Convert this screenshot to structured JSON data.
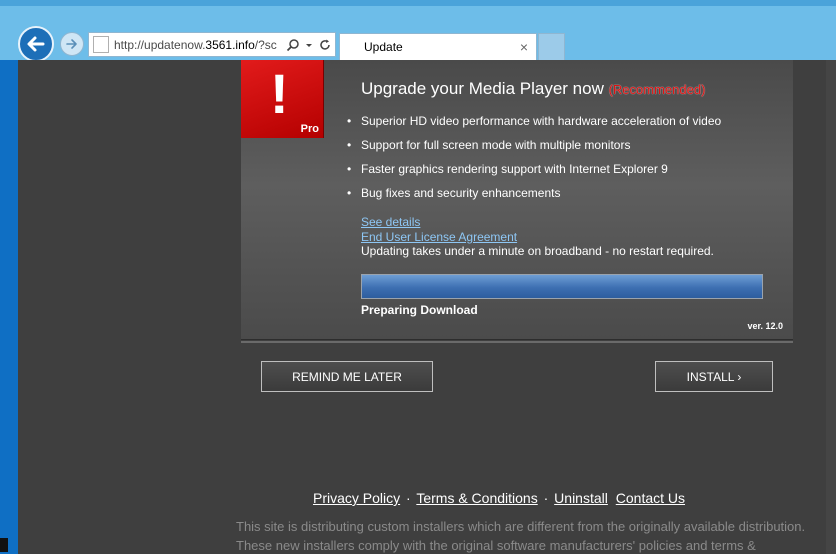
{
  "browser": {
    "url_prefix": "http://updatenow.",
    "url_domain": "3561.info",
    "url_suffix": "/?sc",
    "tab_title": "Update",
    "tab_close": "×"
  },
  "panel": {
    "logo_badge": "Pro",
    "logo_symbol": "!",
    "headline": "Upgrade your Media Player now",
    "recommended": "(Recommended)",
    "features": [
      "Superior HD video performance with hardware acceleration of video",
      "Support for full screen mode with multiple monitors",
      "Faster graphics rendering support with Internet Explorer 9",
      "Bug fixes and security enhancements"
    ],
    "bullet": "•",
    "see_details": "See details",
    "eula": "End User License Agreement",
    "update_note": "Updating takes under a minute on broadband - no restart required.",
    "progress_fraction": 1.0,
    "progress_label": "Preparing Download",
    "version": "ver. 12.0"
  },
  "buttons": {
    "remind_later": "REMIND ME LATER",
    "install": "INSTALL ›"
  },
  "footer": {
    "links": [
      "Privacy Policy",
      "Terms & Conditions",
      "Uninstall",
      "Contact Us"
    ],
    "separator": "·",
    "disclaimer": "This site is distributing custom installers which are different from the originally available distribution. These new installers comply with the original software manufacturers' policies and terms &"
  },
  "colors": {
    "chrome": "#6dbde9",
    "page_bg": "#3f3f3f",
    "logo_red": "#c00000",
    "recommended_red": "#e01010",
    "link_blue": "#8ec7f5",
    "progress_blue": "#3d6fb2"
  },
  "icons": {
    "back": "back-arrow-icon",
    "forward": "forward-arrow-icon",
    "search": "search-icon",
    "dropdown": "chevron-down-icon",
    "refresh": "refresh-icon"
  }
}
